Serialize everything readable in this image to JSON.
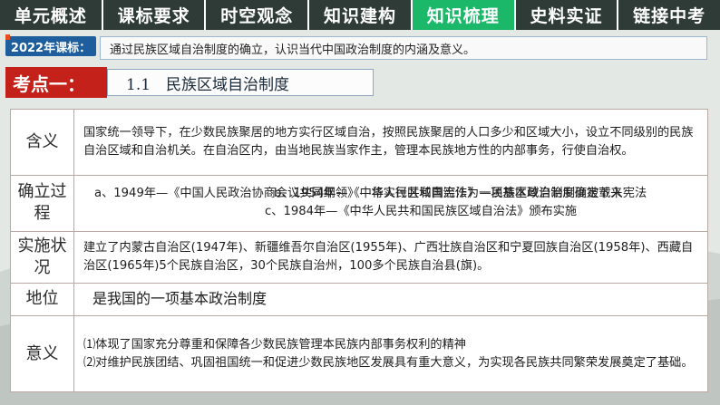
{
  "tabs": [
    {
      "label": "单元概述",
      "active": false
    },
    {
      "label": "课标要求",
      "active": false
    },
    {
      "label": "时空观念",
      "active": false
    },
    {
      "label": "知识建构",
      "active": false
    },
    {
      "label": "知识梳理",
      "active": true
    },
    {
      "label": "史料实证",
      "active": false
    },
    {
      "label": "链接中考",
      "active": false
    }
  ],
  "standard": {
    "tag": "2022年课标：",
    "text": "通过民族区域自治制度的确立，认识当代中国政治制度的内涵及意义。"
  },
  "point": {
    "label": "考点一：",
    "title": "1.1　民族区域自治制度"
  },
  "table": {
    "rows": [
      {
        "label": "含义",
        "lines": [
          "国家统一领导下，在少数民族聚居的地方实行区域自治，按照民族聚居的人口多少和区域大小，设立不同级别的民族自治区域和自治机关。在自治区内，由当地民族当家作主，管理本民族地方性的内部事务，行使自治权。"
        ]
      },
      {
        "label": "确立过程",
        "line_a": "a、1949年—《中国人民政治协商会议共同纲领》—将实行区域自治作为一项基本政治制度确定下来",
        "line_b": "b、1954年—《中华人民共和国宪法》—民族区域自治制度被载入宪法",
        "line_c": "c、1984年—《中华人民共和国民族区域自治法》颁布实施"
      },
      {
        "label": "实施状况",
        "text": "建立了内蒙古自治区(1947年)、新疆维吾尔自治区(1955年)、广西壮族自治区和宁夏回族自治区(1958年)、西藏自治区(1965年)5个民族自治区，30个民族自治州，100多个民族自治县(旗)。"
      },
      {
        "label": "地位",
        "text": "是我国的一项基本政治制度"
      },
      {
        "label": "意义",
        "line1": "⑴体现了国家充分尊重和保障各少数民族管理本民族内部事务权利的精神",
        "line2": "⑵对维护民族团结、巩固祖国统一和促进少数民族地区发展具有重大意义，为实现各民族共同繁荣发展奠定了基础。"
      }
    ]
  }
}
